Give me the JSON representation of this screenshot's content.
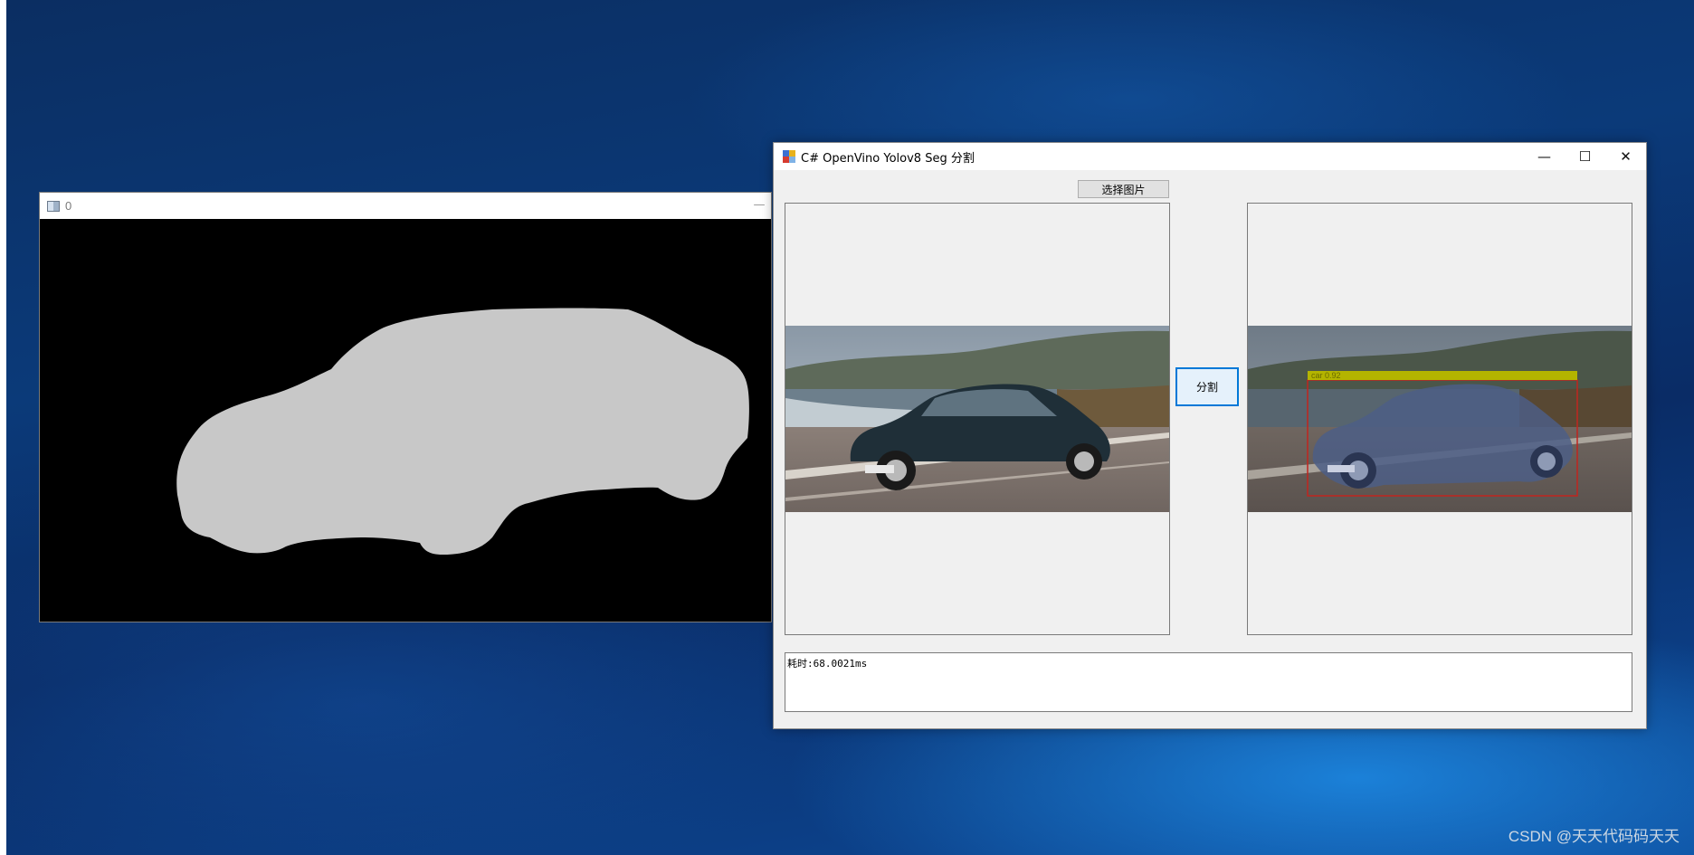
{
  "mask_window": {
    "title": "0"
  },
  "main_window": {
    "title": "C# OpenVino Yolov8 Seg 分割",
    "controls": {
      "minimize": "—",
      "maximize": "☐",
      "close": "✕"
    },
    "select_button_label": "选择图片",
    "split_button_label": "分割",
    "output_text": "耗时:68.0021ms",
    "result_overlay": {
      "detection_label": "car 0.92",
      "box_color": "#c0251f",
      "label_bar_color": "#b4b400",
      "mask_tint": "#4c5e86"
    }
  },
  "watermark": "CSDN @天天代码码天天",
  "colors": {
    "desktop_blue": "#0b3a79",
    "form_background": "#f0f0f0",
    "accent_focus": "#0078d7",
    "mask_fill": "#c8c8c8"
  }
}
